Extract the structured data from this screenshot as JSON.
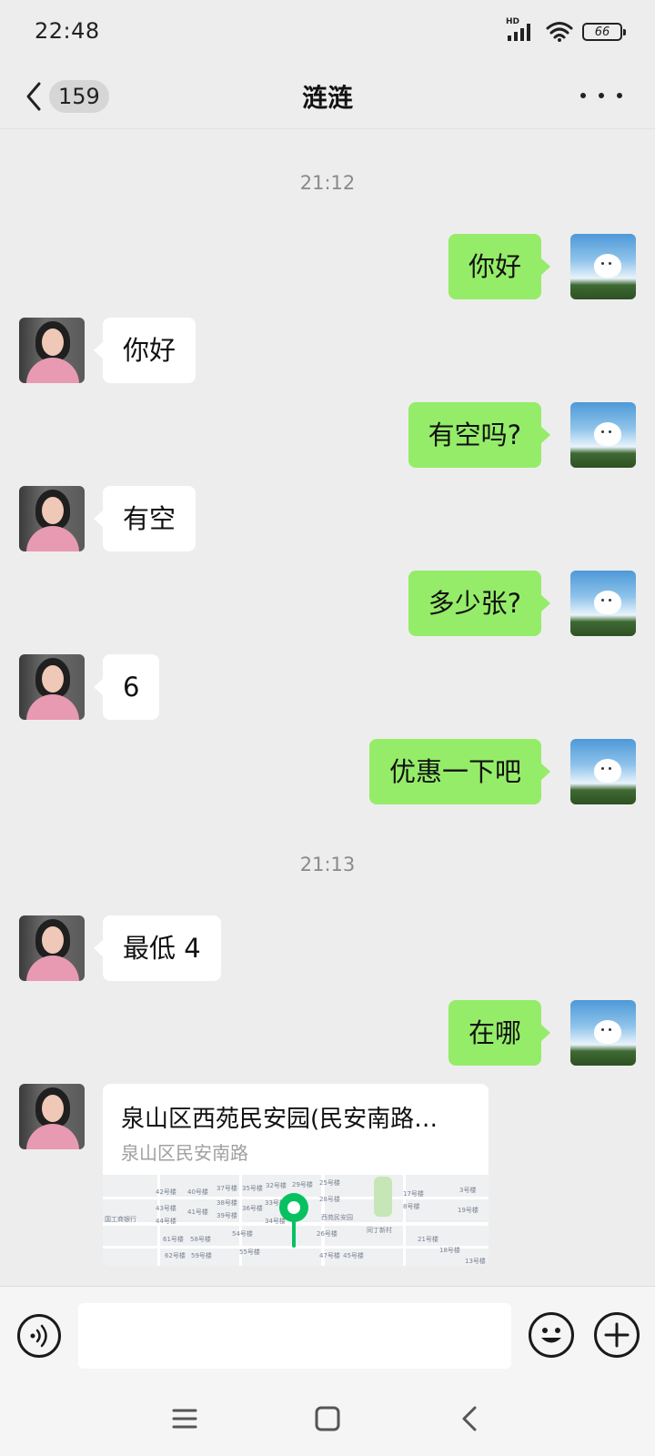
{
  "status_bar": {
    "time": "22:48",
    "network_label": "HD",
    "battery": "66"
  },
  "nav": {
    "unread_count": "159",
    "title": "涟涟"
  },
  "messages": [
    {
      "type": "timestamp",
      "text": "21:12"
    },
    {
      "type": "sent",
      "text": "你好"
    },
    {
      "type": "received",
      "text": "你好"
    },
    {
      "type": "sent",
      "text": "有空吗?"
    },
    {
      "type": "received",
      "text": "有空"
    },
    {
      "type": "sent",
      "text": "多少张?"
    },
    {
      "type": "received",
      "text": "6"
    },
    {
      "type": "sent",
      "text": "优惠一下吧"
    },
    {
      "type": "timestamp",
      "text": "21:13"
    },
    {
      "type": "received",
      "text": "最低 4"
    },
    {
      "type": "sent",
      "text": "在哪"
    },
    {
      "type": "location",
      "title": "泉山区西苑民安园(民安南路…",
      "subtitle": "泉山区民安南路",
      "map_labels": [
        "42号楼",
        "40号楼",
        "37号楼",
        "35号楼",
        "32号楼",
        "29号楼",
        "25号楼",
        "43号楼",
        "41号楼",
        "38号楼",
        "36号楼",
        "33号楼",
        "28号楼",
        "44号楼",
        "39号楼",
        "34号楼",
        "26号楼",
        "61号楼",
        "58号楼",
        "54号楼",
        "62号楼",
        "59号楼",
        "55号楼",
        "47号楼",
        "45号楼",
        "18号楼",
        "17号楼",
        "8号楼",
        "3号楼",
        "21号楼",
        "19号楼",
        "13号楼",
        "西苑民安园",
        "同丁新村",
        "国工商银行"
      ]
    }
  ],
  "input": {
    "placeholder": ""
  },
  "icons": {
    "back": "chevron-left-icon",
    "more": "more-dots-icon",
    "voice": "voice-icon",
    "emoji": "emoji-icon",
    "plus": "plus-icon",
    "menu": "menu-icon",
    "home": "home-icon",
    "sys_back": "back-icon"
  },
  "colors": {
    "sent_bubble": "#95ec69",
    "received_bubble": "#ffffff",
    "background": "#ededed",
    "pin": "#07c160"
  }
}
